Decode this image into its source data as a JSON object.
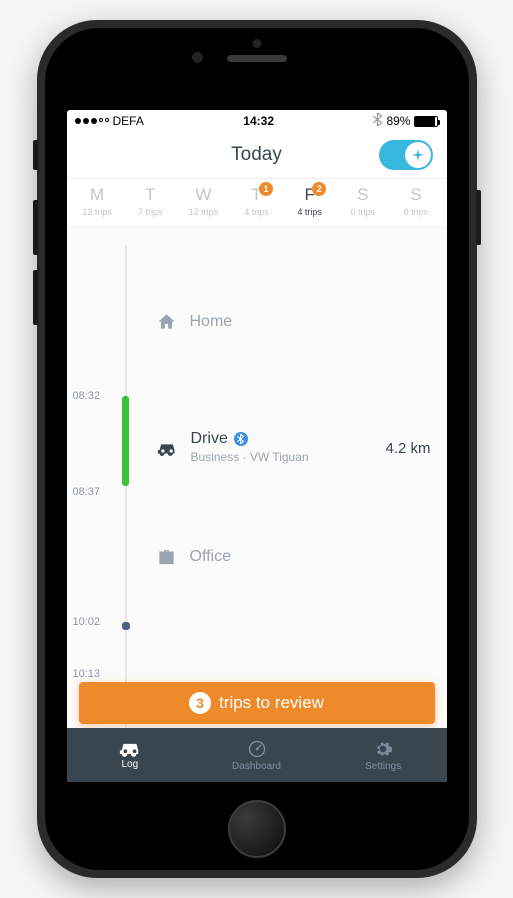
{
  "status_bar": {
    "carrier": "DEFA",
    "time": "14:32",
    "battery_pct": "89%"
  },
  "header": {
    "title": "Today"
  },
  "week": [
    {
      "letter": "M",
      "sub": "13 trips",
      "badge": null,
      "active": false
    },
    {
      "letter": "T",
      "sub": "7 trips",
      "badge": null,
      "active": false
    },
    {
      "letter": "W",
      "sub": "12 trips",
      "badge": null,
      "active": false
    },
    {
      "letter": "T",
      "sub": "4 trips",
      "badge": "1",
      "active": false
    },
    {
      "letter": "F",
      "sub": "4 trips",
      "badge": "2",
      "active": true
    },
    {
      "letter": "S",
      "sub": "0 trips",
      "badge": null,
      "active": false
    },
    {
      "letter": "S",
      "sub": "0 trips",
      "badge": null,
      "active": false
    }
  ],
  "timeline": {
    "home": {
      "label": "Home"
    },
    "drive": {
      "label": "Drive",
      "sub": "Business · VW Tiguan",
      "dist": "4.2 km",
      "t_start": "08:32",
      "t_end": "08:37"
    },
    "office": {
      "label": "Office",
      "t_start": "10:02",
      "t_end": "10:13"
    }
  },
  "banner": {
    "count": "3",
    "text": "trips to review"
  },
  "tabs": {
    "log": "Log",
    "dashboard": "Dashboard",
    "settings": "Settings"
  }
}
